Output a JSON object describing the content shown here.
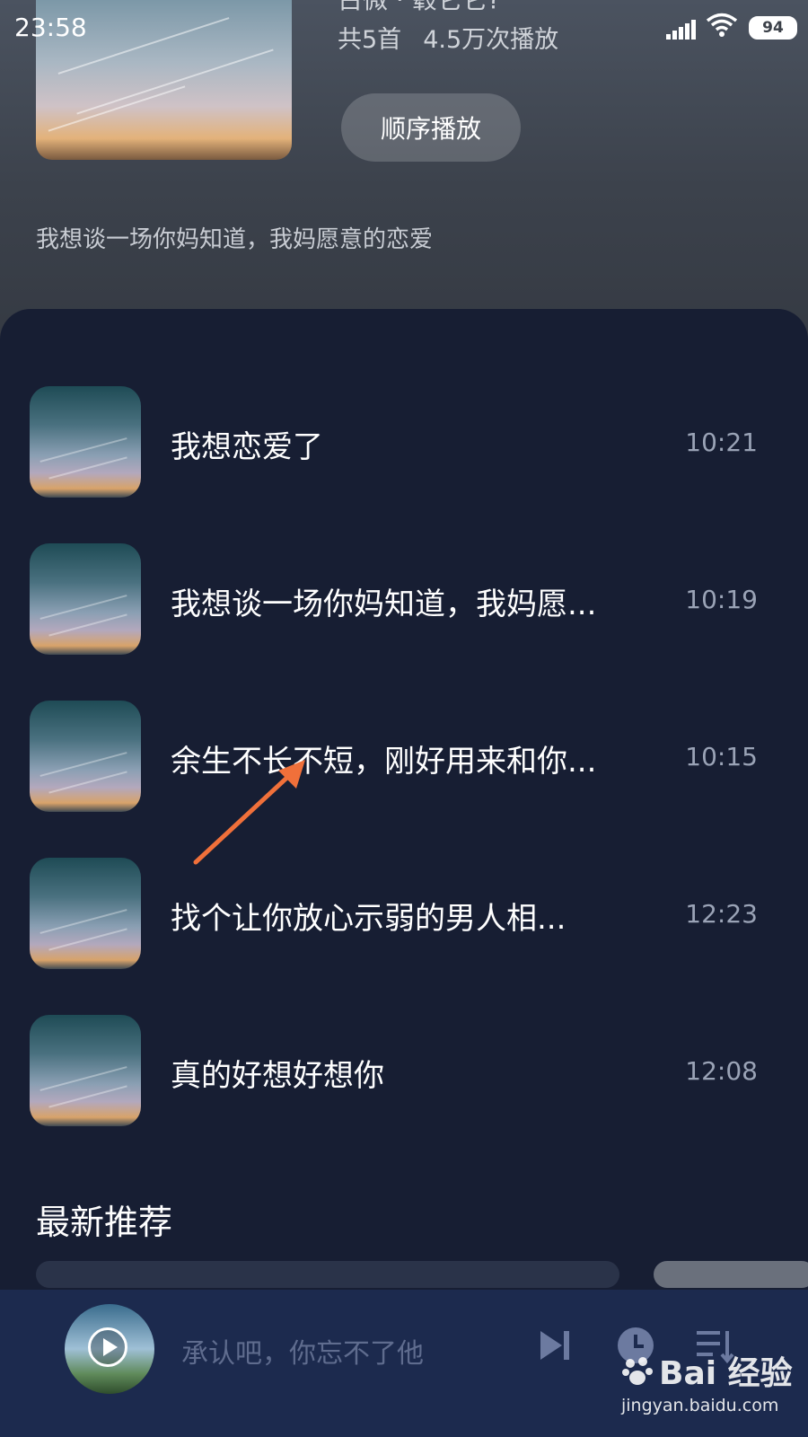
{
  "status_bar": {
    "time": "23:58",
    "battery": "94"
  },
  "album": {
    "title": "古微 · 毂它它?",
    "count": "共5首",
    "plays": "4.5万次播放",
    "play_button": "顺序播放",
    "description": "我想谈一场你妈知道，我妈愿意的恋爱"
  },
  "songs": [
    {
      "title": "我想恋爱了",
      "time": "10:21"
    },
    {
      "title": "我想谈一场你妈知道，我妈愿...",
      "time": "10:19"
    },
    {
      "title": "余生不长不短，刚好用来和你...",
      "time": "10:15"
    },
    {
      "title": "找个让你放心示弱的男人相...",
      "time": "12:23"
    },
    {
      "title": "真的好想好想你",
      "time": "12:08"
    }
  ],
  "section": {
    "title": "最新推荐"
  },
  "player": {
    "now_playing": "承认吧，你忘不了他"
  },
  "watermark": {
    "brand": "Bai 经验",
    "url": "jingyan.baidu.com"
  },
  "colors": {
    "panel": "#171e33",
    "player": "#1c2a4e",
    "annotation_arrow": "#f0703a"
  },
  "icons": [
    "signal-icon",
    "wifi-icon",
    "battery-icon",
    "play-icon",
    "next-track-icon",
    "clock-icon",
    "playlist-icon",
    "paw-icon"
  ]
}
